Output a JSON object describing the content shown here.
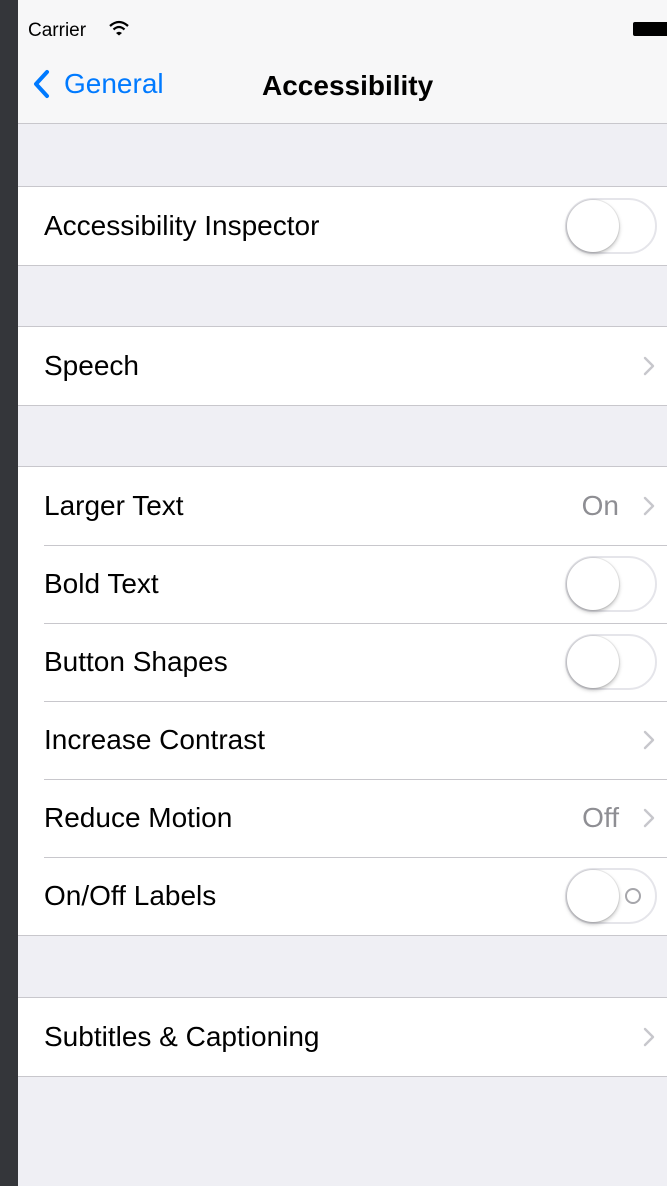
{
  "status_bar": {
    "carrier": "Carrier",
    "icons": [
      "wifi-icon",
      "battery-icon"
    ]
  },
  "nav": {
    "back_label": "General",
    "title": "Accessibility"
  },
  "colors": {
    "accent": "#007aff",
    "group_background": "#efeff4",
    "secondary_text": "#8e8e93",
    "separator": "#c8c7cc"
  },
  "groups": [
    {
      "rows": [
        {
          "label": "Accessibility Inspector",
          "accessory": "toggle",
          "toggle_on": false
        }
      ]
    },
    {
      "rows": [
        {
          "label": "Speech",
          "accessory": "chevron"
        }
      ]
    },
    {
      "rows": [
        {
          "label": "Larger Text",
          "value": "On",
          "accessory": "chevron"
        },
        {
          "label": "Bold Text",
          "accessory": "toggle",
          "toggle_on": false
        },
        {
          "label": "Button Shapes",
          "accessory": "toggle",
          "toggle_on": false
        },
        {
          "label": "Increase Contrast",
          "accessory": "chevron"
        },
        {
          "label": "Reduce Motion",
          "value": "Off",
          "accessory": "chevron"
        },
        {
          "label": "On/Off Labels",
          "accessory": "toggle",
          "toggle_on": false,
          "shows_off_label": true
        }
      ]
    },
    {
      "rows": [
        {
          "label": "Subtitles & Captioning",
          "accessory": "chevron"
        }
      ]
    }
  ]
}
